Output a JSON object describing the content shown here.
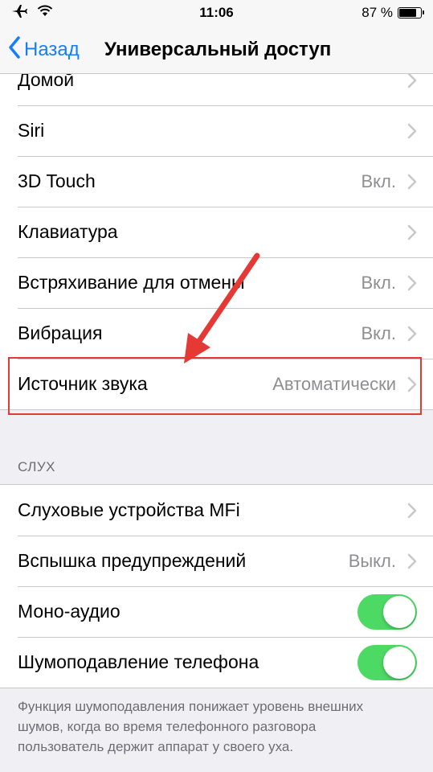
{
  "status_bar": {
    "time": "11:06",
    "battery": "87 %",
    "battery_level_percent": 87,
    "icons": [
      "airplane-icon",
      "wifi-icon",
      "battery-icon"
    ]
  },
  "nav": {
    "back_label": "Назад",
    "title": "Универсальный доступ"
  },
  "group1": {
    "rows": [
      {
        "label": "Домой",
        "value": ""
      },
      {
        "label": "Siri",
        "value": ""
      },
      {
        "label": "3D Touch",
        "value": "Вкл."
      },
      {
        "label": "Клавиатура",
        "value": ""
      },
      {
        "label": "Встряхивание для отмены",
        "value": "Вкл."
      },
      {
        "label": "Вибрация",
        "value": "Вкл."
      },
      {
        "label": "Источник звука",
        "value": "Автоматически"
      }
    ]
  },
  "hearing": {
    "header": "СЛУХ",
    "rows": [
      {
        "label": "Слуховые устройства MFi",
        "value": ""
      },
      {
        "label": "Вспышка предупреждений",
        "value": "Выкл."
      },
      {
        "label": "Моно-аудио",
        "toggle": true
      },
      {
        "label": "Шумоподавление телефона",
        "toggle": true
      }
    ],
    "footer": "Функция шумоподавления понижает уровень внешних шумов, когда во время телефонного разговора пользователь держит аппарат у своего уха."
  },
  "colors": {
    "accent": "#147efb",
    "toggle_on": "#4cd964",
    "annotation": "#e53935",
    "background": "#efeff4"
  }
}
